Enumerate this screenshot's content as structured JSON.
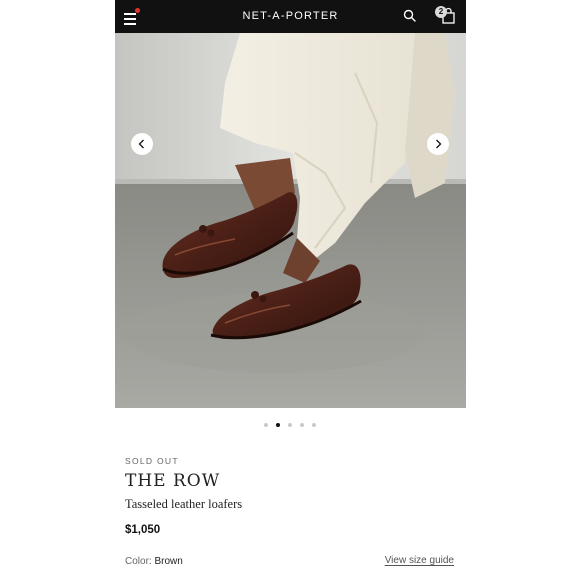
{
  "header": {
    "logo": "NET-A-PORTER",
    "menu_icon": "hamburger-menu-icon",
    "search_icon": "search-icon",
    "bag_icon": "shopping-bag-icon",
    "bag_count": "2",
    "notification_color": "#e4322b",
    "bar_color": "#111111"
  },
  "gallery": {
    "prev_icon": "chevron-left-icon",
    "next_icon": "chevron-right-icon",
    "slide_count": 5,
    "active_index": 1
  },
  "product": {
    "status": "SOLD OUT",
    "brand": "THE ROW",
    "name": "Tasseled leather loafers",
    "price": "$1,050",
    "color_label": "Color:",
    "color_value": "Brown",
    "size_guide_label": "View size guide"
  }
}
